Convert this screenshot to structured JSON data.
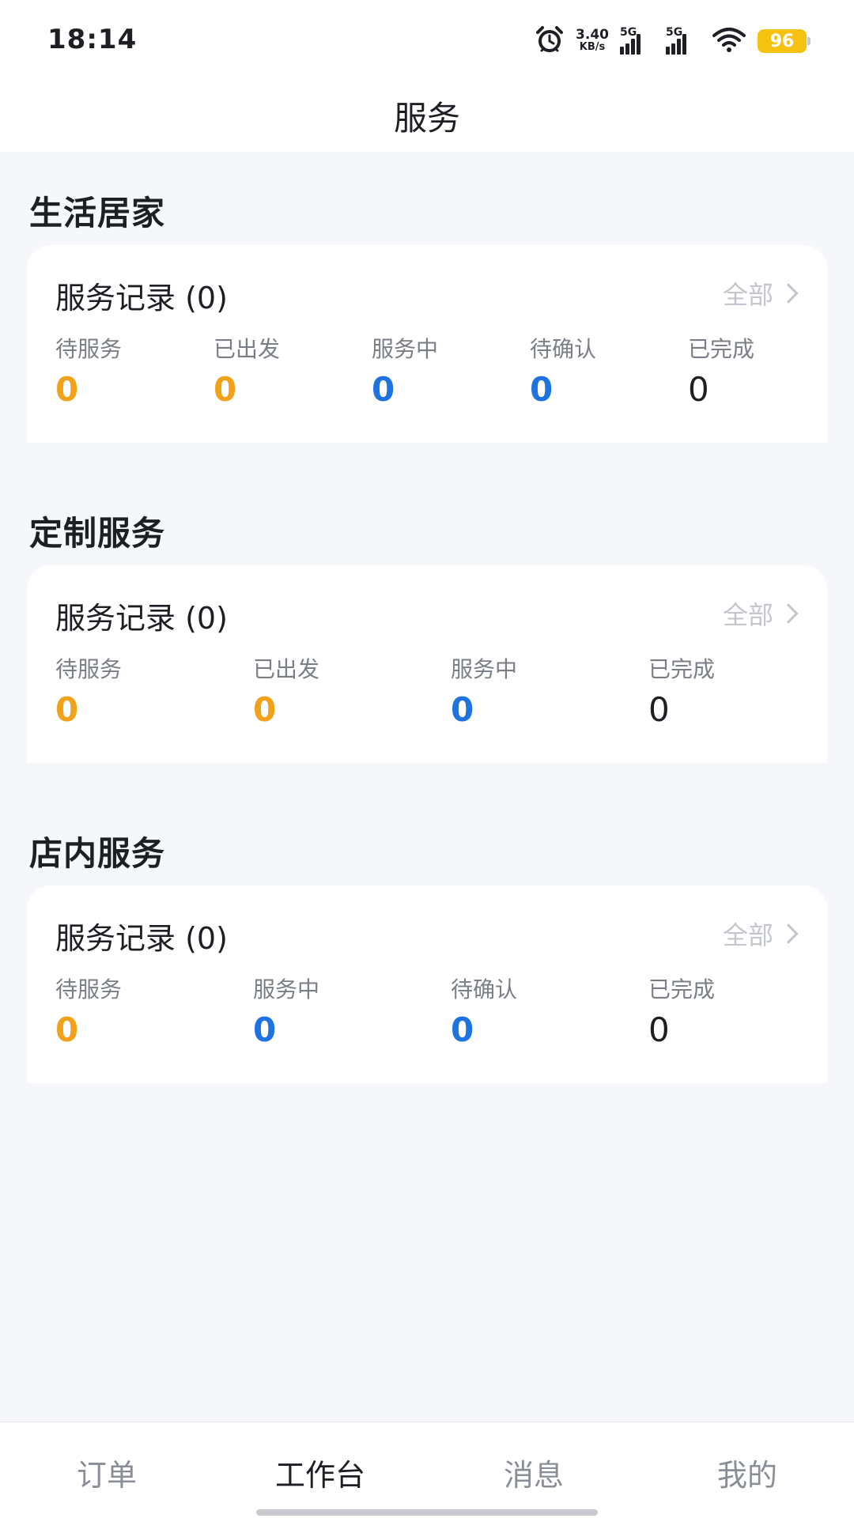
{
  "status_bar": {
    "time": "18:14",
    "net_speed_value": "3.40",
    "net_speed_unit": "KB/s",
    "signal1_label": "5G",
    "signal2_label": "5G",
    "battery": "96",
    "icons": [
      "alarm-icon",
      "signal-icon",
      "wifi-icon",
      "battery-icon"
    ]
  },
  "header": {
    "title": "服务"
  },
  "sections": [
    {
      "title": "生活居家",
      "card_title": "服务记录 (0)",
      "link": "全部",
      "stats": [
        {
          "label": "待服务",
          "value": "0",
          "color": "orange"
        },
        {
          "label": "已出发",
          "value": "0",
          "color": "orange"
        },
        {
          "label": "服务中",
          "value": "0",
          "color": "blue"
        },
        {
          "label": "待确认",
          "value": "0",
          "color": "blue"
        },
        {
          "label": "已完成",
          "value": "0",
          "color": "black"
        }
      ]
    },
    {
      "title": "定制服务",
      "card_title": "服务记录 (0)",
      "link": "全部",
      "stats": [
        {
          "label": "待服务",
          "value": "0",
          "color": "orange"
        },
        {
          "label": "已出发",
          "value": "0",
          "color": "orange"
        },
        {
          "label": "服务中",
          "value": "0",
          "color": "blue"
        },
        {
          "label": "已完成",
          "value": "0",
          "color": "black"
        }
      ]
    },
    {
      "title": "店内服务",
      "card_title": "服务记录 (0)",
      "link": "全部",
      "stats": [
        {
          "label": "待服务",
          "value": "0",
          "color": "orange"
        },
        {
          "label": "服务中",
          "value": "0",
          "color": "blue"
        },
        {
          "label": "待确认",
          "value": "0",
          "color": "blue"
        },
        {
          "label": "已完成",
          "value": "0",
          "color": "black"
        }
      ]
    }
  ],
  "colors": {
    "orange": "#f2a11b",
    "blue": "#1f73e0",
    "black": "#1d1f24",
    "battery": "#f5c30f"
  },
  "bottom_nav": {
    "items": [
      {
        "label": "订单",
        "active": false
      },
      {
        "label": "工作台",
        "active": true
      },
      {
        "label": "消息",
        "active": false
      },
      {
        "label": "我的",
        "active": false
      }
    ]
  }
}
